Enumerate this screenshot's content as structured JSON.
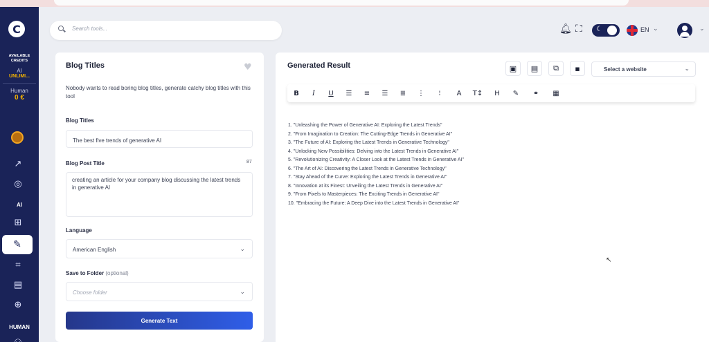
{
  "browser": {
    "url": "(blurred) ...tools/templates/blog-titles"
  },
  "sidebar": {
    "logo_letter": "C",
    "credits_title_line1": "AVAILABLE",
    "credits_title_line2": "CREDITS",
    "ai_label": "AI",
    "ai_value": "UNLIMI...",
    "human_label": "Human",
    "human_value": "0 €",
    "section_ai": "AI",
    "section_human": "HUMAN"
  },
  "header": {
    "search_placeholder": "Search tools...",
    "language": "EN"
  },
  "form": {
    "title": "Blog Titles",
    "description": "Nobody wants to read boring blog titles, generate catchy blog titles with this tool",
    "blog_titles_label": "Blog Titles",
    "blog_titles_value": "The best five trends of generative AI",
    "post_title_label": "Blog Post Title",
    "post_title_count": "87",
    "post_title_value": "creating an article for your company blog discussing the latest trends in generative AI",
    "language_label": "Language",
    "language_value": "American English",
    "folder_label": "Save to Folder",
    "folder_optional": "(optional)",
    "folder_placeholder": "Choose folder",
    "generate_label": "Generate Text"
  },
  "result": {
    "title": "Generated Result",
    "website_select": "Select a website",
    "items": [
      "1. \"Unleashing the Power of Generative AI: Exploring the Latest Trends\"",
      "2. \"From Imagination to Creation: The Cutting-Edge Trends in Generative AI\"",
      "3. \"The Future of AI: Exploring the Latest Trends in Generative Technology\"",
      "4. \"Unlocking New Possibilities: Delving into the Latest Trends in Generative AI\"",
      "5. \"Revolutionizing Creativity: A Closer Look at the Latest Trends in Generative AI\"",
      "6. \"The Art of AI: Discovering the Latest Trends in Generative Technology\"",
      "7. \"Stay Ahead of the Curve: Exploring the Latest Trends in Generative AI\"",
      "8. \"Innovation at its Finest: Unveiling the Latest Trends in Generative AI\"",
      "9. \"From Pixels to Masterpieces: The Exciting Trends in Generative AI\"",
      "10. \"Embracing the Future: A Deep Dive into the Latest Trends in Generative AI\""
    ]
  },
  "toolbar_glyphs": {
    "bold": "B",
    "italic": "I",
    "underline": "U",
    "text_color": "A",
    "text_size": "T↕",
    "heading": "H"
  },
  "icons": {
    "search": "search-icon",
    "bell": "bell-icon",
    "fullscreen": "fullscreen-icon",
    "theme": "dark-mode-toggle-icon",
    "flag": "uk-flag-icon",
    "avatar": "user-avatar-icon",
    "heart": "heart-icon",
    "chevron": "chevron-down-icon"
  },
  "colors": {
    "sidebar": "#1a2358",
    "accent": "#2f5ee8",
    "credit": "#f5b400"
  }
}
